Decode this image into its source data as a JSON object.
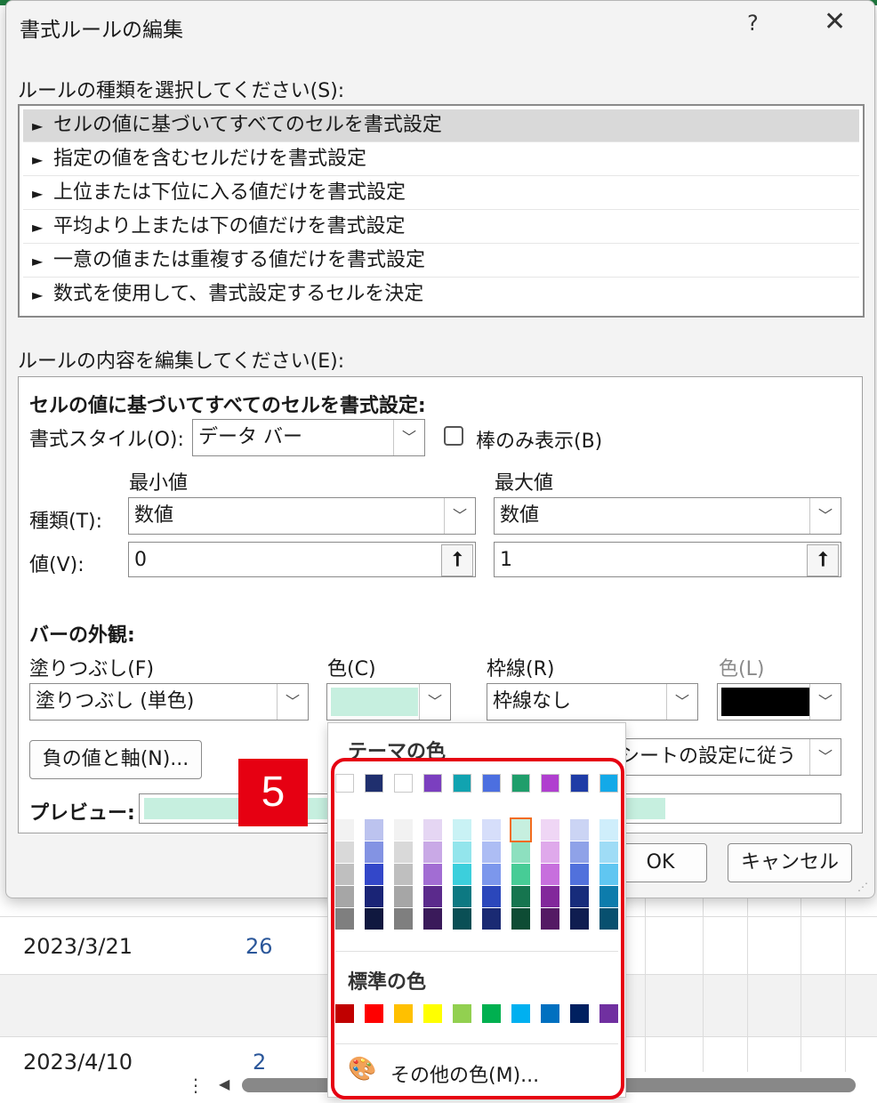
{
  "dialog": {
    "title": "書式ルールの編集",
    "help": "?",
    "close": "✕"
  },
  "rule_type": {
    "label": "ルールの種類を選択してください(S):",
    "items": [
      "セルの値に基づいてすべてのセルを書式設定",
      "指定の値を含むセルだけを書式設定",
      "上位または下位に入る値だけを書式設定",
      "平均より上または下の値だけを書式設定",
      "一意の値または重複する値だけを書式設定",
      "数式を使用して、書式設定するセルを決定"
    ],
    "selected_index": 0,
    "bullet": "►"
  },
  "rule_edit": {
    "label": "ルールの内容を編集してください(E):",
    "heading": "セルの値に基づいてすべてのセルを書式設定:",
    "format_style_label": "書式スタイル(O):",
    "format_style_value": "データ バー",
    "bar_only_label": "棒のみ表示(B)",
    "min_label": "最小値",
    "max_label": "最大値",
    "type_label": "種類(T):",
    "value_label": "値(V):",
    "min_type": "数値",
    "max_type": "数値",
    "min_value": "0",
    "max_value": "1",
    "bar_appearance": "バーの外観:",
    "fill_label": "塗りつぶし(F)",
    "fill_value": "塗りつぶし (単色)",
    "color_label": "色(C)",
    "border_label": "枠線(R)",
    "border_value": "枠線なし",
    "border_color_label": "色(L)",
    "negative_button": "負の値と軸(N)...",
    "direction_value": "シートの設定に従う",
    "preview_label": "プレビュー:",
    "ok": "OK",
    "cancel": "キャンセル",
    "fill_color": "#c6efdf",
    "border_color": "#000000"
  },
  "step_badge": "5",
  "color_popup": {
    "theme_title": "テーマの色",
    "standard_title": "標準の色",
    "more_colors": "その他の色(M)...",
    "theme_colors": [
      "#ffffff",
      "#1f2f6e",
      "#ffffff",
      "#7b3fbf",
      "#11a3b0",
      "#4c6fe0",
      "#1f9e6b",
      "#b03fcf",
      "#1f3ca6",
      "#13a9e8"
    ],
    "theme_shades": [
      [
        "#f2f2f2",
        "#d9d9d9",
        "#bfbfbf",
        "#a6a6a6",
        "#7f7f7f"
      ],
      [
        "#bcc3ef",
        "#8393e3",
        "#3347c9",
        "#1a2476",
        "#10183f"
      ],
      [
        "#f2f2f2",
        "#d9d9d9",
        "#bfbfbf",
        "#a6a6a6",
        "#7f7f7f"
      ],
      [
        "#e5d6f3",
        "#c9a9e6",
        "#a26dd3",
        "#5b2a8c",
        "#3a1a5a"
      ],
      [
        "#c9f2f5",
        "#93e5ec",
        "#3ccfdc",
        "#0d7982",
        "#0a4f55"
      ],
      [
        "#d6defa",
        "#adbdf4",
        "#7c97ec",
        "#2b47bb",
        "#1a2a73"
      ],
      [
        "#c6efdf",
        "#8de0bf",
        "#47cc96",
        "#16754f",
        "#0e4c34"
      ],
      [
        "#efd6f5",
        "#dfa9eb",
        "#c76fdd",
        "#82289b",
        "#541a64"
      ],
      [
        "#cbd4f4",
        "#8fa2e8",
        "#5171dc",
        "#172c7b",
        "#0f1d50"
      ],
      [
        "#cfeefb",
        "#9fdcf6",
        "#60c6f1",
        "#0d7cac",
        "#08506f"
      ]
    ],
    "selected_shade": [
      6,
      0
    ],
    "standard_colors": [
      "#c00000",
      "#ff0000",
      "#ffc000",
      "#ffff00",
      "#92d050",
      "#00b050",
      "#00b0f0",
      "#0070c0",
      "#002060",
      "#7030a0"
    ]
  },
  "sheet": {
    "row1_date": "2023/3/21",
    "row1_value": "26",
    "row2_date": "2023/4/10",
    "row2_value": "2"
  }
}
